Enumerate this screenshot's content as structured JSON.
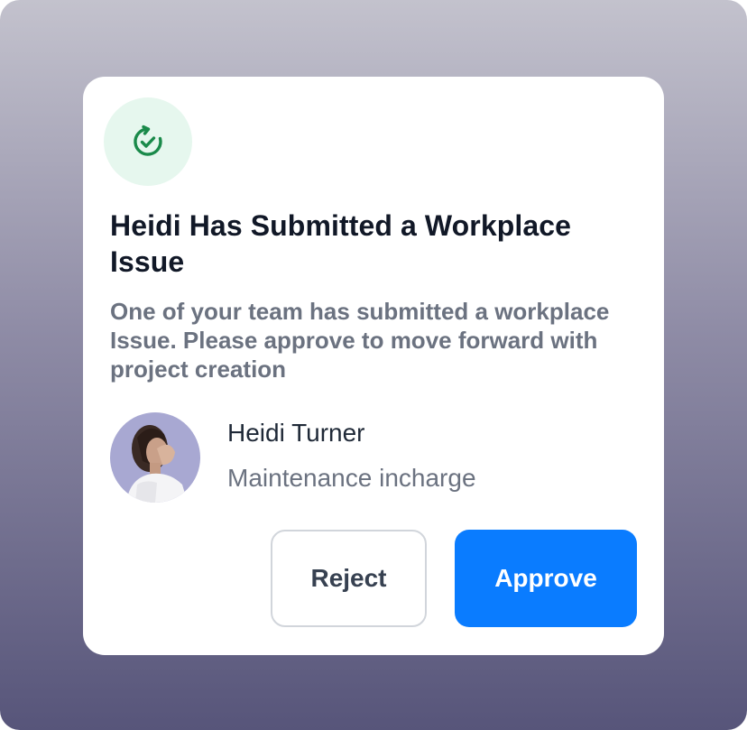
{
  "notification": {
    "status_icon": "refresh-check-icon",
    "title": "Heidi Has Submitted a Workplace Issue",
    "description": "One of your team has submitted a workplace Issue. Please approve to move forward with project creation"
  },
  "submitter": {
    "name": "Heidi Turner",
    "role": "Maintenance incharge"
  },
  "actions": {
    "reject_label": "Reject",
    "approve_label": "Approve"
  },
  "colors": {
    "accent": "#0a7cff",
    "success": "#1a8a4a",
    "success_bg": "#e6f7ee",
    "title_text": "#111827",
    "muted_text": "#6b7280"
  }
}
